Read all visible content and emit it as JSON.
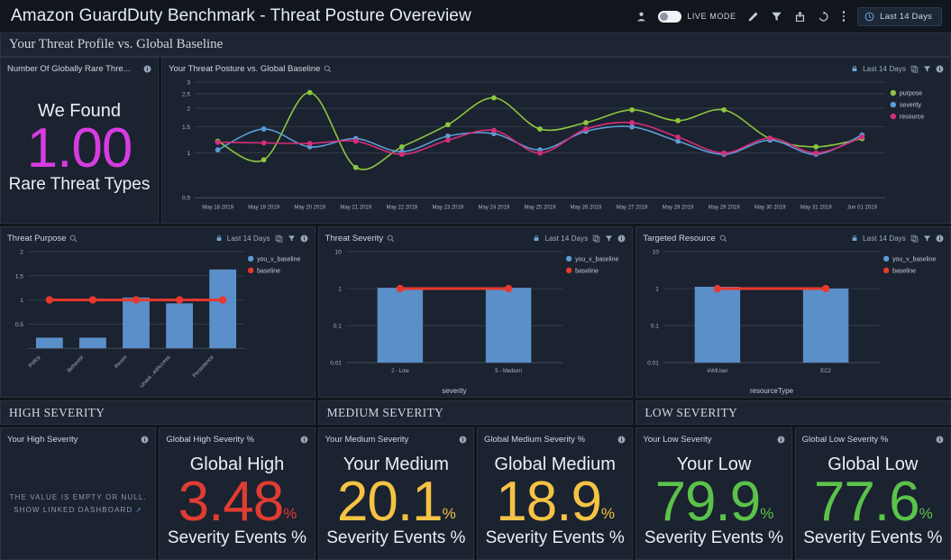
{
  "header": {
    "title": "Amazon GuardDuty Benchmark - Threat Posture Overeview",
    "live_mode_label": "LIVE MODE",
    "time_range": "Last 14 Days",
    "icons": {
      "user": "user-icon",
      "edit": "pencil-icon",
      "filter": "filter-icon",
      "share": "share-icon",
      "refresh": "refresh-icon",
      "more": "kebab-menu-icon",
      "clock": "clock-icon"
    }
  },
  "sections": {
    "profile": "Your Threat Profile vs. Global Baseline",
    "high": "HIGH SEVERITY",
    "medium": "MEDIUM SEVERITY",
    "low": "LOW SEVERITY"
  },
  "rare_threats": {
    "panel_title": "Number Of Globally Rare Thre...",
    "top_label": "We Found",
    "value": "1.00",
    "bottom_label": "Rare Threat Types",
    "color": "#d63ce0"
  },
  "posture": {
    "panel_title": "Your Threat Posture vs. Global Baseline",
    "time_range": "Last 14 Days"
  },
  "purpose": {
    "panel_title": "Threat Purpose",
    "time_range": "Last 14 Days"
  },
  "severity": {
    "panel_title": "Threat Severity",
    "time_range": "Last 14 Days"
  },
  "resource": {
    "panel_title": "Targeted Resource",
    "time_range": "Last 14 Days"
  },
  "kpis": {
    "your_high": {
      "panel_title": "Your High Severity",
      "empty_line1": "THE VALUE IS EMPTY OR NULL.",
      "empty_line2": "SHOW LINKED DASHBOARD"
    },
    "global_high": {
      "panel_title": "Global High Severity %",
      "top_label": "Global High",
      "value": "3.48",
      "suffix": "%",
      "bottom_label": "Severity Events %",
      "color": "#e03c31"
    },
    "your_medium": {
      "panel_title": "Your Medium Severity",
      "top_label": "Your Medium",
      "value": "20.1",
      "suffix": "%",
      "bottom_label": "Severity Events %",
      "color": "#f5c344"
    },
    "global_medium": {
      "panel_title": "Global Medium Severity %",
      "top_label": "Global Medium",
      "value": "18.9",
      "suffix": "%",
      "bottom_label": "Severity Events %",
      "color": "#f5c344"
    },
    "your_low": {
      "panel_title": "Your Low Severity",
      "top_label": "Your Low",
      "value": "79.9",
      "suffix": "%",
      "bottom_label": "Severity Events %",
      "color": "#5bc24a"
    },
    "global_low": {
      "panel_title": "Global Low Severity %",
      "top_label": "Global Low",
      "value": "77.6",
      "suffix": "%",
      "bottom_label": "Severity Events %",
      "color": "#5bc24a"
    }
  },
  "chart_data": [
    {
      "id": "posture",
      "type": "line",
      "title": "Your Threat Posture vs. Global Baseline",
      "xlabel": "",
      "ylabel": "",
      "ylim": [
        0.5,
        3
      ],
      "yticks": [
        3,
        2.5,
        2,
        1.5,
        1,
        0.5
      ],
      "grid": true,
      "legend_position": "right",
      "x": [
        "May 18 2019",
        "May 19 2019",
        "May 20 2019",
        "May 21 2019",
        "May 22 2019",
        "May 23 2019",
        "May 24 2019",
        "May 25 2019",
        "May 26 2019",
        "May 27 2019",
        "May 28 2019",
        "May 29 2019",
        "May 30 2019",
        "May 31 2019",
        "Jun 01 2019"
      ],
      "series": [
        {
          "name": "purpose",
          "color": "#8cc63e",
          "values": [
            1.2,
            0.9,
            2.55,
            0.8,
            1.1,
            1.55,
            2.35,
            1.45,
            1.6,
            1.95,
            1.65,
            1.95,
            1.25,
            1.1,
            1.25
          ]
        },
        {
          "name": "severity",
          "color": "#5b9bd5",
          "values": [
            1.05,
            1.45,
            1.1,
            1.25,
            1.02,
            1.3,
            1.35,
            1.05,
            1.4,
            1.5,
            1.2,
            0.98,
            1.22,
            0.98,
            1.32
          ]
        },
        {
          "name": "resource",
          "color": "#d62d7a",
          "values": [
            1.18,
            1.17,
            1.16,
            1.2,
            0.98,
            1.22,
            1.42,
            1.0,
            1.45,
            1.6,
            1.28,
            1.0,
            1.26,
            1.0,
            1.28
          ]
        }
      ]
    },
    {
      "id": "purpose",
      "type": "bar",
      "title": "Threat Purpose",
      "xlabel": "",
      "ylabel": "",
      "ylim": [
        0,
        2
      ],
      "yticks": [
        2,
        1.5,
        1,
        0.5
      ],
      "grid": true,
      "legend_position": "right",
      "legend": [
        "you_v_baseline",
        "baseline"
      ],
      "legend_colors": [
        "#5b9bd5",
        "#e8392e"
      ],
      "categories": [
        "Policy",
        "Behavior",
        "Recon",
        "Unaut...edAccess",
        "Persistence"
      ],
      "values": [
        0.22,
        0.22,
        1.05,
        0.93,
        1.63
      ],
      "baseline": [
        1,
        1,
        1,
        1,
        1
      ]
    },
    {
      "id": "severity",
      "type": "bar",
      "title": "Threat Severity",
      "xlabel": "severity",
      "ylabel": "",
      "yscale": "log",
      "ylim": [
        0.01,
        10
      ],
      "yticks": [
        10,
        1,
        0.1,
        0.01
      ],
      "grid": true,
      "legend_position": "right",
      "legend": [
        "you_v_baseline",
        "baseline"
      ],
      "legend_colors": [
        "#5b9bd5",
        "#e8392e"
      ],
      "categories": [
        "2 - Low",
        "5 - Medium"
      ],
      "values": [
        1.05,
        1.05
      ],
      "baseline": [
        1,
        1
      ]
    },
    {
      "id": "resource",
      "type": "bar",
      "title": "Targeted Resource",
      "xlabel": "resourceType",
      "ylabel": "",
      "yscale": "log",
      "ylim": [
        0.01,
        10
      ],
      "yticks": [
        10,
        1,
        0.1,
        0.01
      ],
      "grid": true,
      "legend_position": "right",
      "legend": [
        "you_v_baseline",
        "baseline"
      ],
      "legend_colors": [
        "#5b9bd5",
        "#e8392e"
      ],
      "categories": [
        "IAMUser",
        "EC2"
      ],
      "values": [
        1.12,
        1.0
      ],
      "baseline": [
        1,
        1
      ]
    }
  ]
}
